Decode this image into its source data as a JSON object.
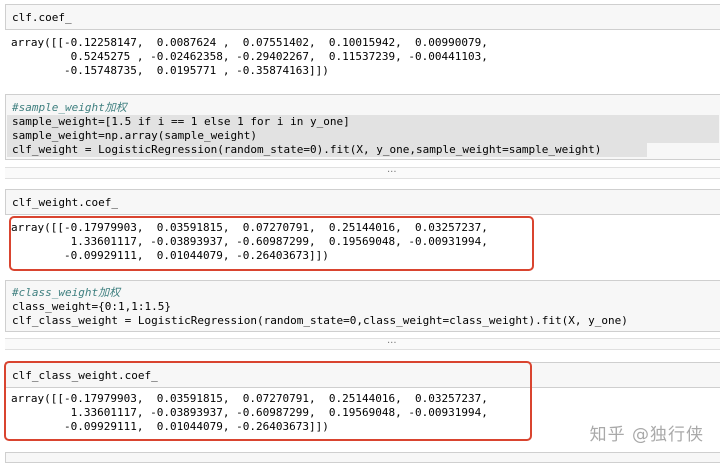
{
  "cells": {
    "coef_input": "clf.coef_",
    "coef_output": [
      "array([[-0.12258147,  0.0087624 ,  0.07551402,  0.10015942,  0.00990079,",
      "         0.5245275 , -0.02462358, -0.29402267,  0.11537239, -0.00441103,",
      "        -0.15748735,  0.0195771 , -0.35874163]])"
    ],
    "sample_weight_code": [
      "#sample_weight加权",
      "sample_weight=[1.5 if i == 1 else 1 for i in y_one]",
      "sample_weight=np.array(sample_weight)",
      "clf_weight = LogisticRegression(random_state=0).fit(X, y_one,sample_weight=sample_weight)"
    ],
    "weight_coef_input": "clf_weight.coef_",
    "weight_coef_output": [
      "array([[-0.17979903,  0.03591815,  0.07270791,  0.25144016,  0.03257237,",
      "         1.33601117, -0.03893937, -0.60987299,  0.19569048, -0.00931994,",
      "        -0.09929111,  0.01044079, -0.26403673]])"
    ],
    "class_weight_code": [
      "#class_weight加权",
      "class_weight={0:1,1:1.5}",
      "clf_class_weight = LogisticRegression(random_state=0,class_weight=class_weight).fit(X, y_one)"
    ],
    "class_weight_coef_input": "clf_class_weight.coef_",
    "class_weight_coef_output": [
      "array([[-0.17979903,  0.03591815,  0.07270791,  0.25144016,  0.03257237,",
      "         1.33601117, -0.03893937, -0.60987299,  0.19569048, -0.00931994,",
      "        -0.09929111,  0.01044079, -0.26403673]])"
    ]
  },
  "ellipsis": "...",
  "watermark": "知乎 @独行侠",
  "colors": {
    "highlight_box": "#d9442f",
    "cell_background": "#f7f7f7",
    "keyword": "#008000",
    "comment": "#408080"
  }
}
